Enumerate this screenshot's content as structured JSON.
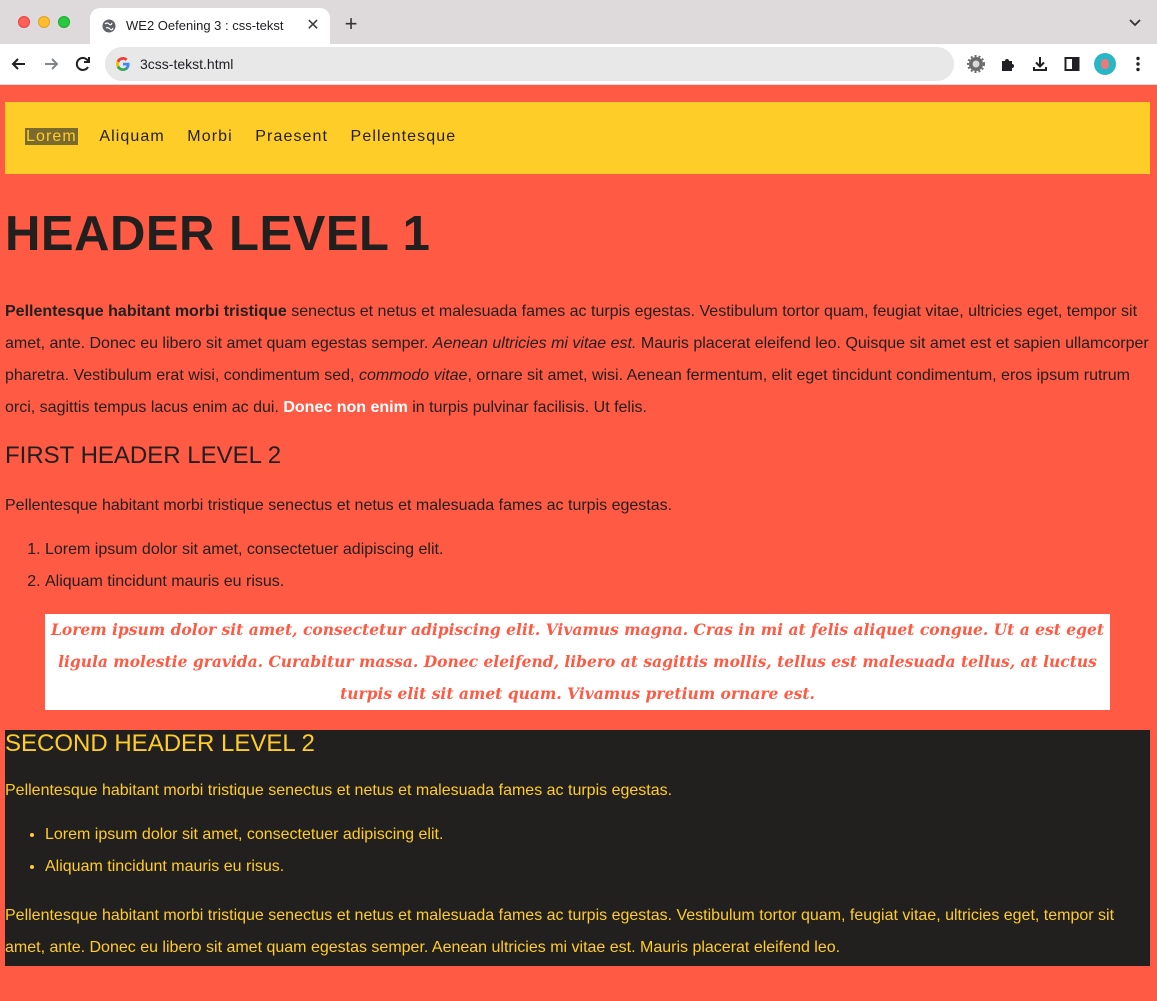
{
  "browser": {
    "tab_title": "WE2 Oefening 3 : css-tekst",
    "url": "3css-tekst.html"
  },
  "nav": {
    "items": [
      "Lorem",
      "Aliquam",
      "Morbi",
      "Praesent",
      "Pellentesque"
    ],
    "active": "Lorem"
  },
  "content": {
    "h1": "HEADER LEVEL 1",
    "para1": {
      "bold": "Pellentesque habitant morbi tristique",
      "text1": " senectus et netus et malesuada fames ac turpis egestas. Vestibulum tortor quam, feugiat vitae, ultricies eget, tempor sit amet, ante. Donec eu libero sit amet quam egestas semper. ",
      "italic1": "Aenean ultricies mi vitae est.",
      "text2": " Mauris placerat eleifend leo. Quisque sit amet est et sapien ullamcorper pharetra. Vestibulum erat wisi, condimentum sed, ",
      "italic2": "commodo vitae",
      "text3": ", ornare sit amet, wisi. Aenean fermentum, elit eget tincidunt condimentum, eros ipsum rutrum orci, sagittis tempus lacus enim ac dui. ",
      "white": "Donec non enim",
      "text4": " in turpis pulvinar facilisis. Ut felis."
    },
    "h2_first": "FIRST HEADER LEVEL 2",
    "para2": "Pellentesque habitant morbi tristique senectus et netus et malesuada fames ac turpis egestas.",
    "ordered_list": [
      "Lorem ipsum dolor sit amet, consectetuer adipiscing elit.",
      "Aliquam tincidunt mauris eu risus."
    ],
    "blockquote": "Lorem ipsum dolor sit amet, consectetur adipiscing elit. Vivamus magna. Cras in mi at felis aliquet congue. Ut a est eget ligula molestie gravida. Curabitur massa. Donec eleifend, libero at sagittis mollis, tellus est malesuada tellus, at luctus turpis elit sit amet quam. Vivamus pretium ornare est.",
    "h2_second": "SECOND HEADER LEVEL 2",
    "para3": "Pellentesque habitant morbi tristique senectus et netus et malesuada fames ac turpis egestas.",
    "unordered_list": [
      "Lorem ipsum dolor sit amet, consectetuer adipiscing elit.",
      "Aliquam tincidunt mauris eu risus."
    ],
    "para4": "Pellentesque habitant morbi tristique senectus et netus et malesuada fames ac turpis egestas. Vestibulum tortor quam, feugiat vitae, ultricies eget, tempor sit amet, ante. Donec eu libero sit amet quam egestas semper. Aenean ultricies mi vitae est. Mauris placerat eleifend leo."
  },
  "colors": {
    "page_bg": "#ff5a44",
    "nav_bg": "#ffcd27",
    "dark_bg": "#221f1f",
    "dark_text": "#ffcd27"
  },
  "icons": {
    "tab_favicon": "globe-icon",
    "omnibox": "google-icon",
    "toolbar": [
      "extension-gear-icon",
      "puzzle-icon",
      "download-icon",
      "side-panel-icon",
      "avatar",
      "kebab-menu-icon"
    ]
  }
}
